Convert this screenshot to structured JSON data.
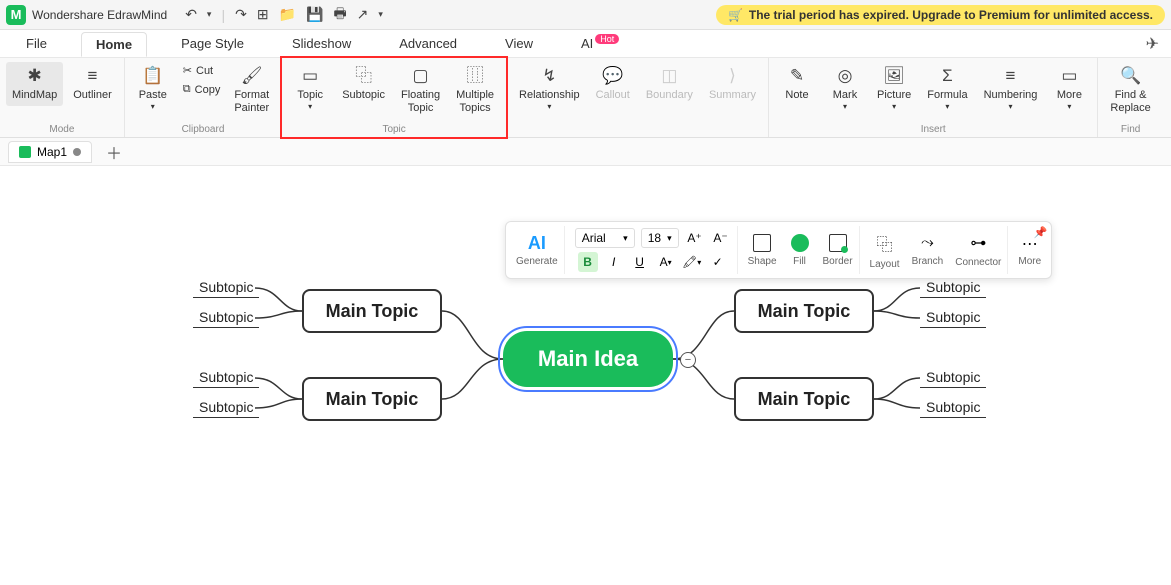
{
  "app": {
    "name": "Wondershare EdrawMind",
    "logo_letter": "M"
  },
  "trial": {
    "cart_icon": "🛒",
    "text": "The trial period has expired. Upgrade to Premium for unlimited access."
  },
  "menu": {
    "file": "File",
    "home": "Home",
    "page_style": "Page Style",
    "slideshow": "Slideshow",
    "advanced": "Advanced",
    "view": "View",
    "ai": "AI",
    "hot": "Hot"
  },
  "ribbon": {
    "mode_label": "Mode",
    "mindmap": "MindMap",
    "outliner": "Outliner",
    "clipboard_label": "Clipboard",
    "paste": "Paste",
    "cut": "Cut",
    "copy": "Copy",
    "format_painter": "Format\nPainter",
    "topic_label": "Topic",
    "topic": "Topic",
    "subtopic": "Subtopic",
    "floating_topic": "Floating\nTopic",
    "multiple_topics": "Multiple\nTopics",
    "relationship": "Relationship",
    "callout": "Callout",
    "boundary": "Boundary",
    "summary": "Summary",
    "insert_label": "Insert",
    "note": "Note",
    "mark": "Mark",
    "picture": "Picture",
    "formula": "Formula",
    "numbering": "Numbering",
    "more": "More",
    "find_label": "Find",
    "find_replace": "Find &\nReplace"
  },
  "doc_tab": {
    "name": "Map1"
  },
  "float": {
    "ai": "AI",
    "generate": "Generate",
    "font": "Arial",
    "size": "18",
    "shape": "Shape",
    "fill": "Fill",
    "border": "Border",
    "layout": "Layout",
    "branch": "Branch",
    "connector": "Connector",
    "more": "More"
  },
  "mindmap": {
    "main_idea": "Main Idea",
    "main_topic": "Main Topic",
    "subtopic": "Subtopic"
  }
}
